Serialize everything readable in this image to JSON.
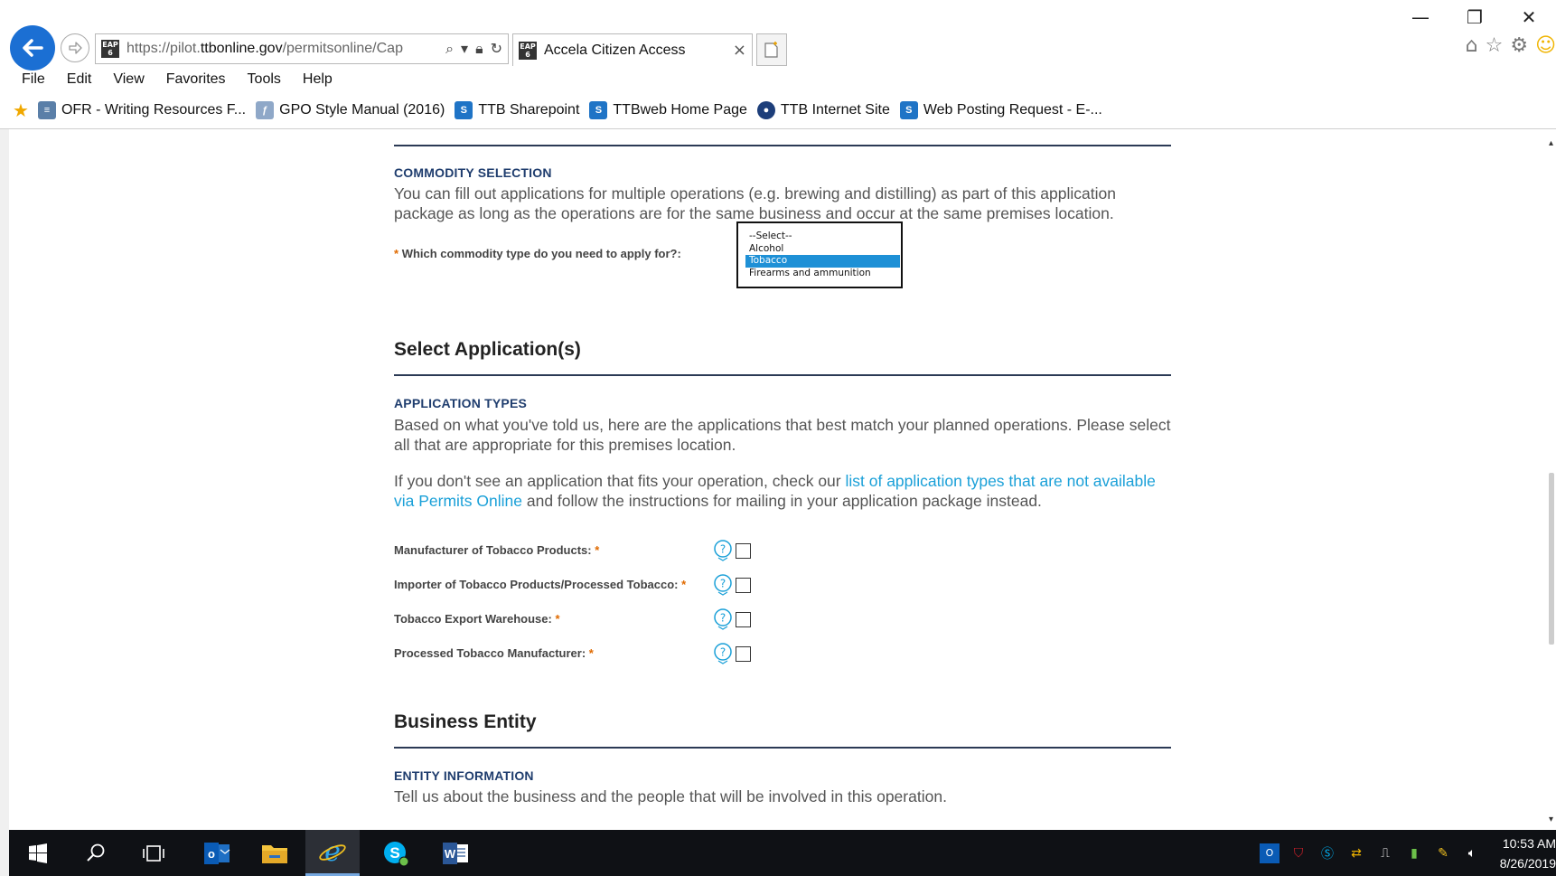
{
  "window": {
    "minimize_glyph": "—",
    "restore_glyph": "❐",
    "close_glyph": "✕"
  },
  "address_bar": {
    "favicon_text": "EAP 6",
    "url_prefix": "https://pilot.",
    "url_domain": "ttbonline.gov",
    "url_path": "/permitsonline/Cap"
  },
  "tab": {
    "favicon_text": "EAP 6",
    "title": "Accela Citizen Access",
    "close_glyph": "×"
  },
  "menu": [
    "File",
    "Edit",
    "View",
    "Favorites",
    "Tools",
    "Help"
  ],
  "favorites": [
    {
      "label": "OFR - Writing Resources F...",
      "icon": "document-icon",
      "kind": "doc"
    },
    {
      "label": "GPO Style Manual (2016)",
      "icon": "gpo-icon",
      "kind": "gpo"
    },
    {
      "label": "TTB Sharepoint",
      "icon": "sharepoint-icon",
      "kind": "sp"
    },
    {
      "label": "TTBweb Home Page",
      "icon": "sharepoint-icon",
      "kind": "sp"
    },
    {
      "label": "TTB Internet Site",
      "icon": "ttb-seal-icon",
      "kind": "ttb"
    },
    {
      "label": "Web Posting Request - E-...",
      "icon": "sharepoint-icon",
      "kind": "sp"
    }
  ],
  "commodity": {
    "subheading": "COMMODITY SELECTION",
    "description": "You can fill out applications for multiple operations (e.g. brewing and distilling) as part of this application package as long as the operations are for the same business and occur at the same premises location.",
    "required_marker": "*",
    "label": "Which commodity type do you need to apply for?:",
    "options": [
      "--Select--",
      "Alcohol",
      "Tobacco",
      "Firearms and ammunition"
    ],
    "selected_option": "Tobacco"
  },
  "select_applications": {
    "title": "Select Application(s)",
    "subheading": "APPLICATION TYPES",
    "description": "Based on what you've told us, here are the applications that best match your planned operations. Please select all that are appropriate for this premises location.",
    "note_before_link": "If you don't see an application that fits your operation, check our ",
    "note_link": "list of application types that are not available via Permits Online",
    "note_after_link": " and follow the instructions for mailing in your application package instead.",
    "items": [
      {
        "label": "Manufacturer of Tobacco Products:",
        "required": "*",
        "checked": false
      },
      {
        "label": "Importer of Tobacco Products/Processed Tobacco:",
        "required": "*",
        "checked": false
      },
      {
        "label": "Tobacco Export Warehouse:",
        "required": "*",
        "checked": false
      },
      {
        "label": "Processed Tobacco Manufacturer:",
        "required": "*",
        "checked": false
      }
    ]
  },
  "business_entity": {
    "title": "Business Entity",
    "subheading": "ENTITY INFORMATION",
    "description": "Tell us about the business and the people that will be involved in this operation."
  },
  "taskbar": {
    "apps": [
      "windows-start-icon",
      "search-icon",
      "task-view-icon",
      "outlook-icon",
      "file-explorer-icon",
      "internet-explorer-icon",
      "skype-icon",
      "word-icon"
    ],
    "active_app": "internet-explorer-icon"
  },
  "clock": {
    "time": "10:53 AM",
    "date": "8/26/2019"
  },
  "colors": {
    "accent_blue": "#1b6fd3",
    "link": "#1aa0d8",
    "subheading": "#1f3d6e",
    "required": "#e06a00",
    "listbox_selected": "#1e90d6"
  }
}
